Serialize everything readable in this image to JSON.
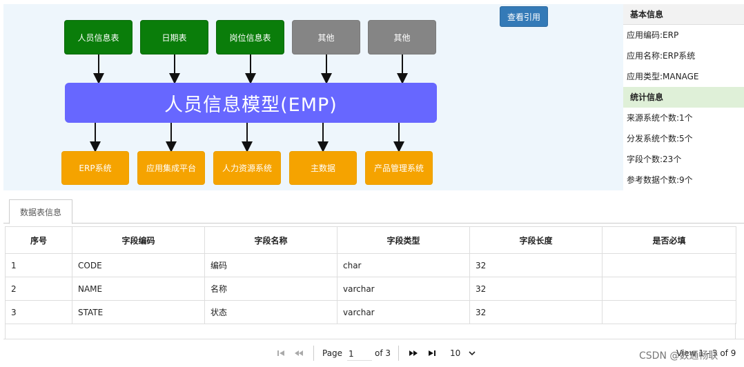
{
  "diagram": {
    "sources": [
      {
        "label": "人员信息表",
        "color": "green"
      },
      {
        "label": "日期表",
        "color": "green"
      },
      {
        "label": "岗位信息表",
        "color": "green"
      },
      {
        "label": "其他",
        "color": "gray"
      },
      {
        "label": "其他",
        "color": "gray"
      }
    ],
    "center": "人员信息模型(EMP)",
    "targets": [
      {
        "label": "ERP系统"
      },
      {
        "label": "应用集成平台"
      },
      {
        "label": "人力资源系统"
      },
      {
        "label": "主数据"
      },
      {
        "label": "产品管理系统"
      }
    ],
    "colors": {
      "green": "#0a7d0a",
      "gray": "#858585",
      "center": "#6767ff",
      "orange": "#f5a300"
    }
  },
  "actions": {
    "view_ref": "查看引用"
  },
  "info": {
    "basic_title": "基本信息",
    "basic": [
      "应用编码:ERP",
      "应用名称:ERP系统",
      "应用类型:MANAGE"
    ],
    "stats_title": "统计信息",
    "stats": [
      "来源系统个数:1个",
      "分发系统个数:5个",
      "字段个数:23个",
      "参考数据个数:9个"
    ]
  },
  "tabs": [
    {
      "label": "数据表信息",
      "active": true
    }
  ],
  "table": {
    "columns": [
      "序号",
      "字段编码",
      "字段名称",
      "字段类型",
      "字段长度",
      "是否必填"
    ],
    "rows": [
      [
        "1",
        "CODE",
        "编码",
        "char",
        "32",
        ""
      ],
      [
        "2",
        "NAME",
        "名称",
        "varchar",
        "32",
        ""
      ],
      [
        "3",
        "STATE",
        "状态",
        "varchar",
        "32",
        ""
      ]
    ]
  },
  "pager": {
    "page_label": "Page",
    "page_value": "1",
    "of_label": "of 3",
    "page_size": "10",
    "view_info": "View 1 - 3 of 9"
  },
  "watermark": "CSDN @数通畅联"
}
